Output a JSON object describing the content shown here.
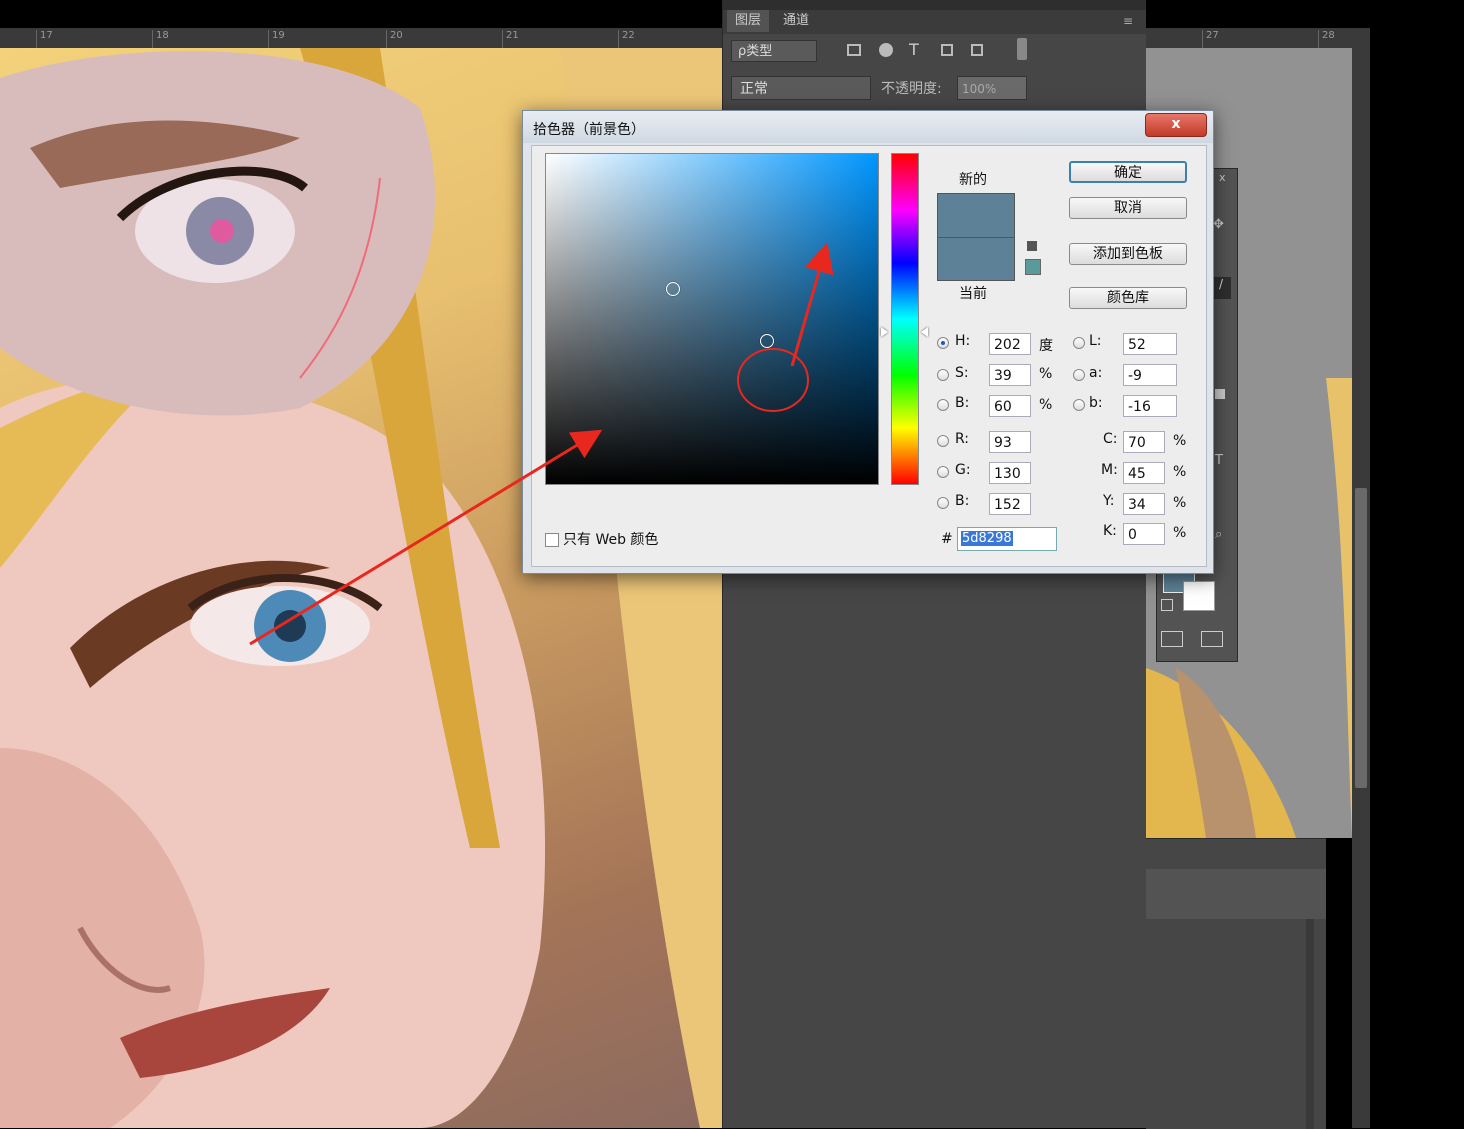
{
  "ruler": {
    "marks": [
      "17",
      "18",
      "19",
      "20",
      "21",
      "22",
      "27",
      "28"
    ]
  },
  "layers_panel": {
    "tabs": [
      "图层",
      "通道"
    ],
    "filter_label": "ρ类型",
    "blend_mode": "正常",
    "opacity_label": "不透明度:",
    "opacity_value": "100%"
  },
  "dialog": {
    "title": "拾色器（前景色）",
    "close_label": "x",
    "new_label": "新的",
    "current_label": "当前",
    "new_color": "#5d8298",
    "current_color": "#5d8298",
    "buttons": {
      "ok": "确定",
      "cancel": "取消",
      "add_to_swatches": "添加到色板",
      "color_libraries": "颜色库"
    },
    "only_web_colors": "只有 Web 颜色",
    "hsb": {
      "h": {
        "label": "H:",
        "value": "202",
        "unit": "度"
      },
      "s": {
        "label": "S:",
        "value": "39",
        "unit": "%"
      },
      "b": {
        "label": "B:",
        "value": "60",
        "unit": "%"
      }
    },
    "rgb": {
      "r": {
        "label": "R:",
        "value": "93"
      },
      "g": {
        "label": "G:",
        "value": "130"
      },
      "b": {
        "label": "B:",
        "value": "152"
      }
    },
    "lab": {
      "l": {
        "label": "L:",
        "value": "52"
      },
      "a": {
        "label": "a:",
        "value": "-9"
      },
      "b": {
        "label": "b:",
        "value": "-16"
      }
    },
    "cmyk": {
      "c": {
        "label": "C:",
        "value": "70",
        "unit": "%"
      },
      "m": {
        "label": "M:",
        "value": "45",
        "unit": "%"
      },
      "y": {
        "label": "Y:",
        "value": "34",
        "unit": "%"
      },
      "k": {
        "label": "K:",
        "value": "0",
        "unit": "%"
      }
    },
    "hex_prefix": "#",
    "hex_value": "5d8298"
  },
  "colors": {
    "annotation_red": "#e8281e",
    "foreground_swatch": "#5d8298",
    "background_swatch": "#ffffff"
  }
}
